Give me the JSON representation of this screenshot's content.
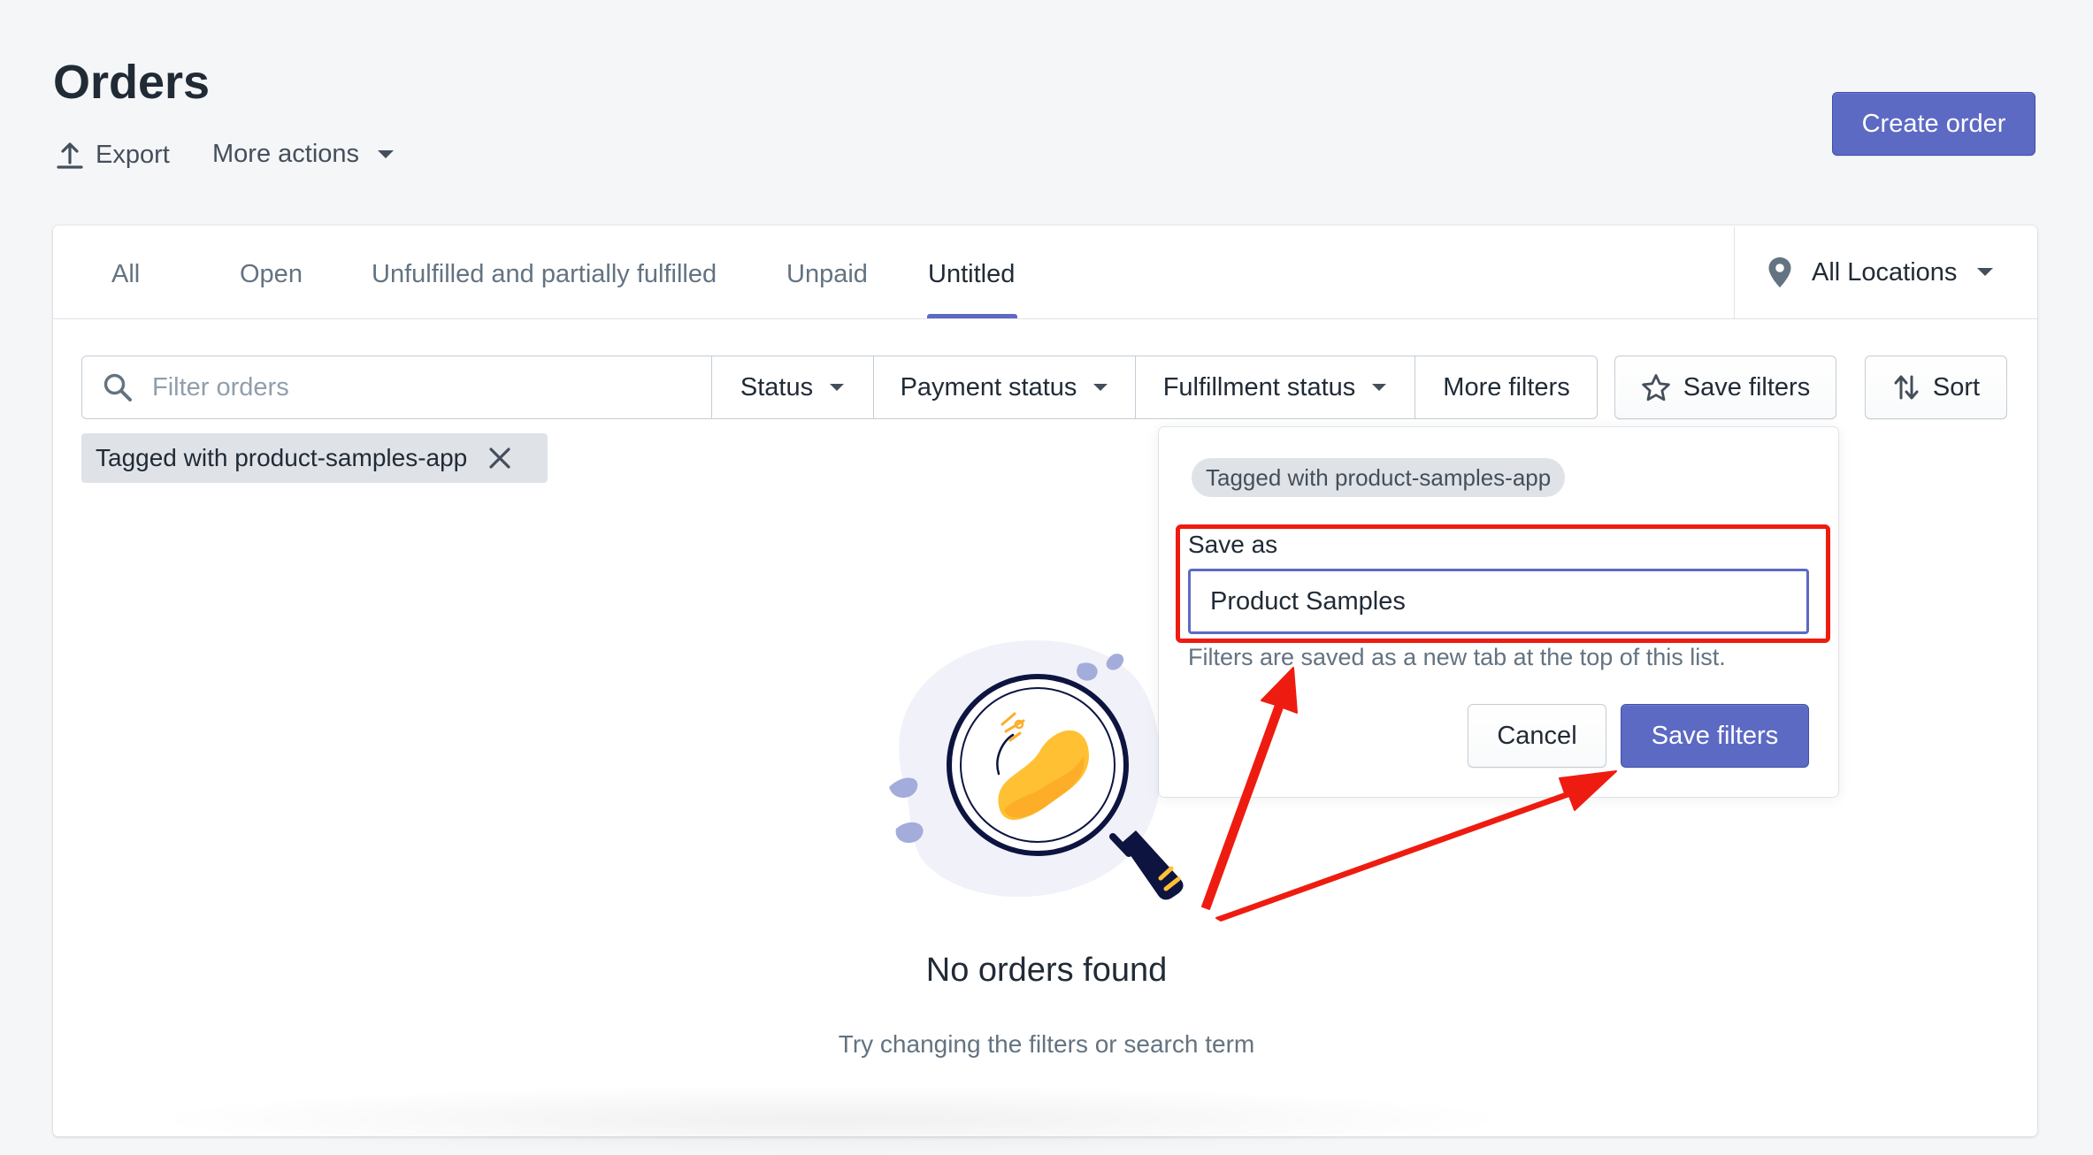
{
  "header": {
    "title": "Orders",
    "export_label": "Export",
    "more_actions_label": "More actions",
    "create_label": "Create order"
  },
  "tabs": [
    {
      "label": "All"
    },
    {
      "label": "Open"
    },
    {
      "label": "Unfulfilled and partially fulfilled"
    },
    {
      "label": "Unpaid"
    },
    {
      "label": "Untitled",
      "selected": true
    }
  ],
  "location": {
    "label": "All Locations"
  },
  "filters": {
    "search_placeholder": "Filter orders",
    "status_label": "Status",
    "payment_label": "Payment status",
    "fulfillment_label": "Fulfillment status",
    "more_label": "More filters",
    "save_label": "Save filters",
    "sort_label": "Sort"
  },
  "applied_filter": {
    "label": "Tagged with product-samples-app"
  },
  "save_popover": {
    "tag": "Tagged with product-samples-app",
    "field_label": "Save as",
    "field_value": "Product Samples",
    "help_text": "Filters are saved as a new tab at the top of this list.",
    "cancel_label": "Cancel",
    "submit_label": "Save filters"
  },
  "empty_state": {
    "title": "No orders found",
    "subtitle": "Try changing the filters or search term"
  },
  "colors": {
    "primary": "#5c6ac4",
    "annotation": "#ee1c10",
    "illustration_yellow": "#ffc133",
    "illustration_navy": "#0d1440"
  }
}
